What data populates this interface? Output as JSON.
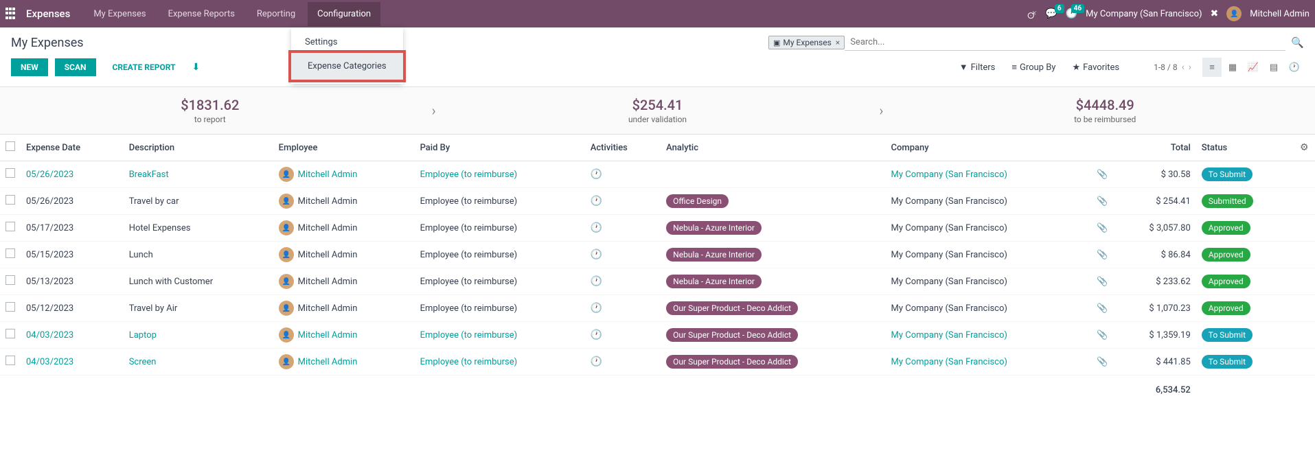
{
  "topbar": {
    "title": "Expenses",
    "menu": [
      "My Expenses",
      "Expense Reports",
      "Reporting",
      "Configuration"
    ],
    "badges": {
      "chat": "6",
      "activity": "46"
    },
    "company": "My Company (San Francisco)",
    "user": "Mitchell Admin"
  },
  "dropdown": {
    "items": [
      "Settings",
      "Expense Categories"
    ],
    "highlighted_index": 1
  },
  "page": {
    "title": "My Expenses",
    "buttons": {
      "new": "NEW",
      "scan": "SCAN",
      "create_report": "CREATE REPORT"
    },
    "search_chip": "My Expenses",
    "search_placeholder": "Search...",
    "filters": {
      "filters": "Filters",
      "group_by": "Group By",
      "favorites": "Favorites"
    },
    "pager": "1-8 / 8"
  },
  "summary": [
    {
      "amount": "$1831.62",
      "label": "to report"
    },
    {
      "amount": "$254.41",
      "label": "under validation"
    },
    {
      "amount": "$4448.49",
      "label": "to be reimbursed"
    }
  ],
  "columns": {
    "date": "Expense Date",
    "desc": "Description",
    "emp": "Employee",
    "paid": "Paid By",
    "act": "Activities",
    "ana": "Analytic",
    "comp": "Company",
    "total": "Total",
    "status": "Status"
  },
  "rows": [
    {
      "date": "05/26/2023",
      "desc": "BreakFast",
      "emp": "Mitchell Admin",
      "paid": "Employee (to reimburse)",
      "ana": "",
      "comp": "My Company (San Francisco)",
      "total": "$ 30.58",
      "status": "To Submit",
      "status_cls": "st-tosubmit",
      "link": true
    },
    {
      "date": "05/26/2023",
      "desc": "Travel by car",
      "emp": "Mitchell Admin",
      "paid": "Employee (to reimburse)",
      "ana": "Office Design",
      "comp": "My Company (San Francisco)",
      "total": "$ 254.41",
      "status": "Submitted",
      "status_cls": "st-submitted",
      "link": false
    },
    {
      "date": "05/17/2023",
      "desc": "Hotel Expenses",
      "emp": "Mitchell Admin",
      "paid": "Employee (to reimburse)",
      "ana": "Nebula - Azure Interior",
      "comp": "My Company (San Francisco)",
      "total": "$ 3,057.80",
      "status": "Approved",
      "status_cls": "st-approved",
      "link": false
    },
    {
      "date": "05/15/2023",
      "desc": "Lunch",
      "emp": "Mitchell Admin",
      "paid": "Employee (to reimburse)",
      "ana": "Nebula - Azure Interior",
      "comp": "My Company (San Francisco)",
      "total": "$ 86.84",
      "status": "Approved",
      "status_cls": "st-approved",
      "link": false
    },
    {
      "date": "05/13/2023",
      "desc": "Lunch with Customer",
      "emp": "Mitchell Admin",
      "paid": "Employee (to reimburse)",
      "ana": "Nebula - Azure Interior",
      "comp": "My Company (San Francisco)",
      "total": "$ 233.62",
      "status": "Approved",
      "status_cls": "st-approved",
      "link": false
    },
    {
      "date": "05/12/2023",
      "desc": "Travel by Air",
      "emp": "Mitchell Admin",
      "paid": "Employee (to reimburse)",
      "ana": "Our Super Product - Deco Addict",
      "comp": "My Company (San Francisco)",
      "total": "$ 1,070.23",
      "status": "Approved",
      "status_cls": "st-approved",
      "link": false
    },
    {
      "date": "04/03/2023",
      "desc": "Laptop",
      "emp": "Mitchell Admin",
      "paid": "Employee (to reimburse)",
      "ana": "Our Super Product - Deco Addict",
      "comp": "My Company (San Francisco)",
      "total": "$ 1,359.19",
      "status": "To Submit",
      "status_cls": "st-tosubmit",
      "link": true
    },
    {
      "date": "04/03/2023",
      "desc": "Screen",
      "emp": "Mitchell Admin",
      "paid": "Employee (to reimburse)",
      "ana": "Our Super Product - Deco Addict",
      "comp": "My Company (San Francisco)",
      "total": "$ 441.85",
      "status": "To Submit",
      "status_cls": "st-tosubmit",
      "link": true
    }
  ],
  "footer_total": "6,534.52"
}
